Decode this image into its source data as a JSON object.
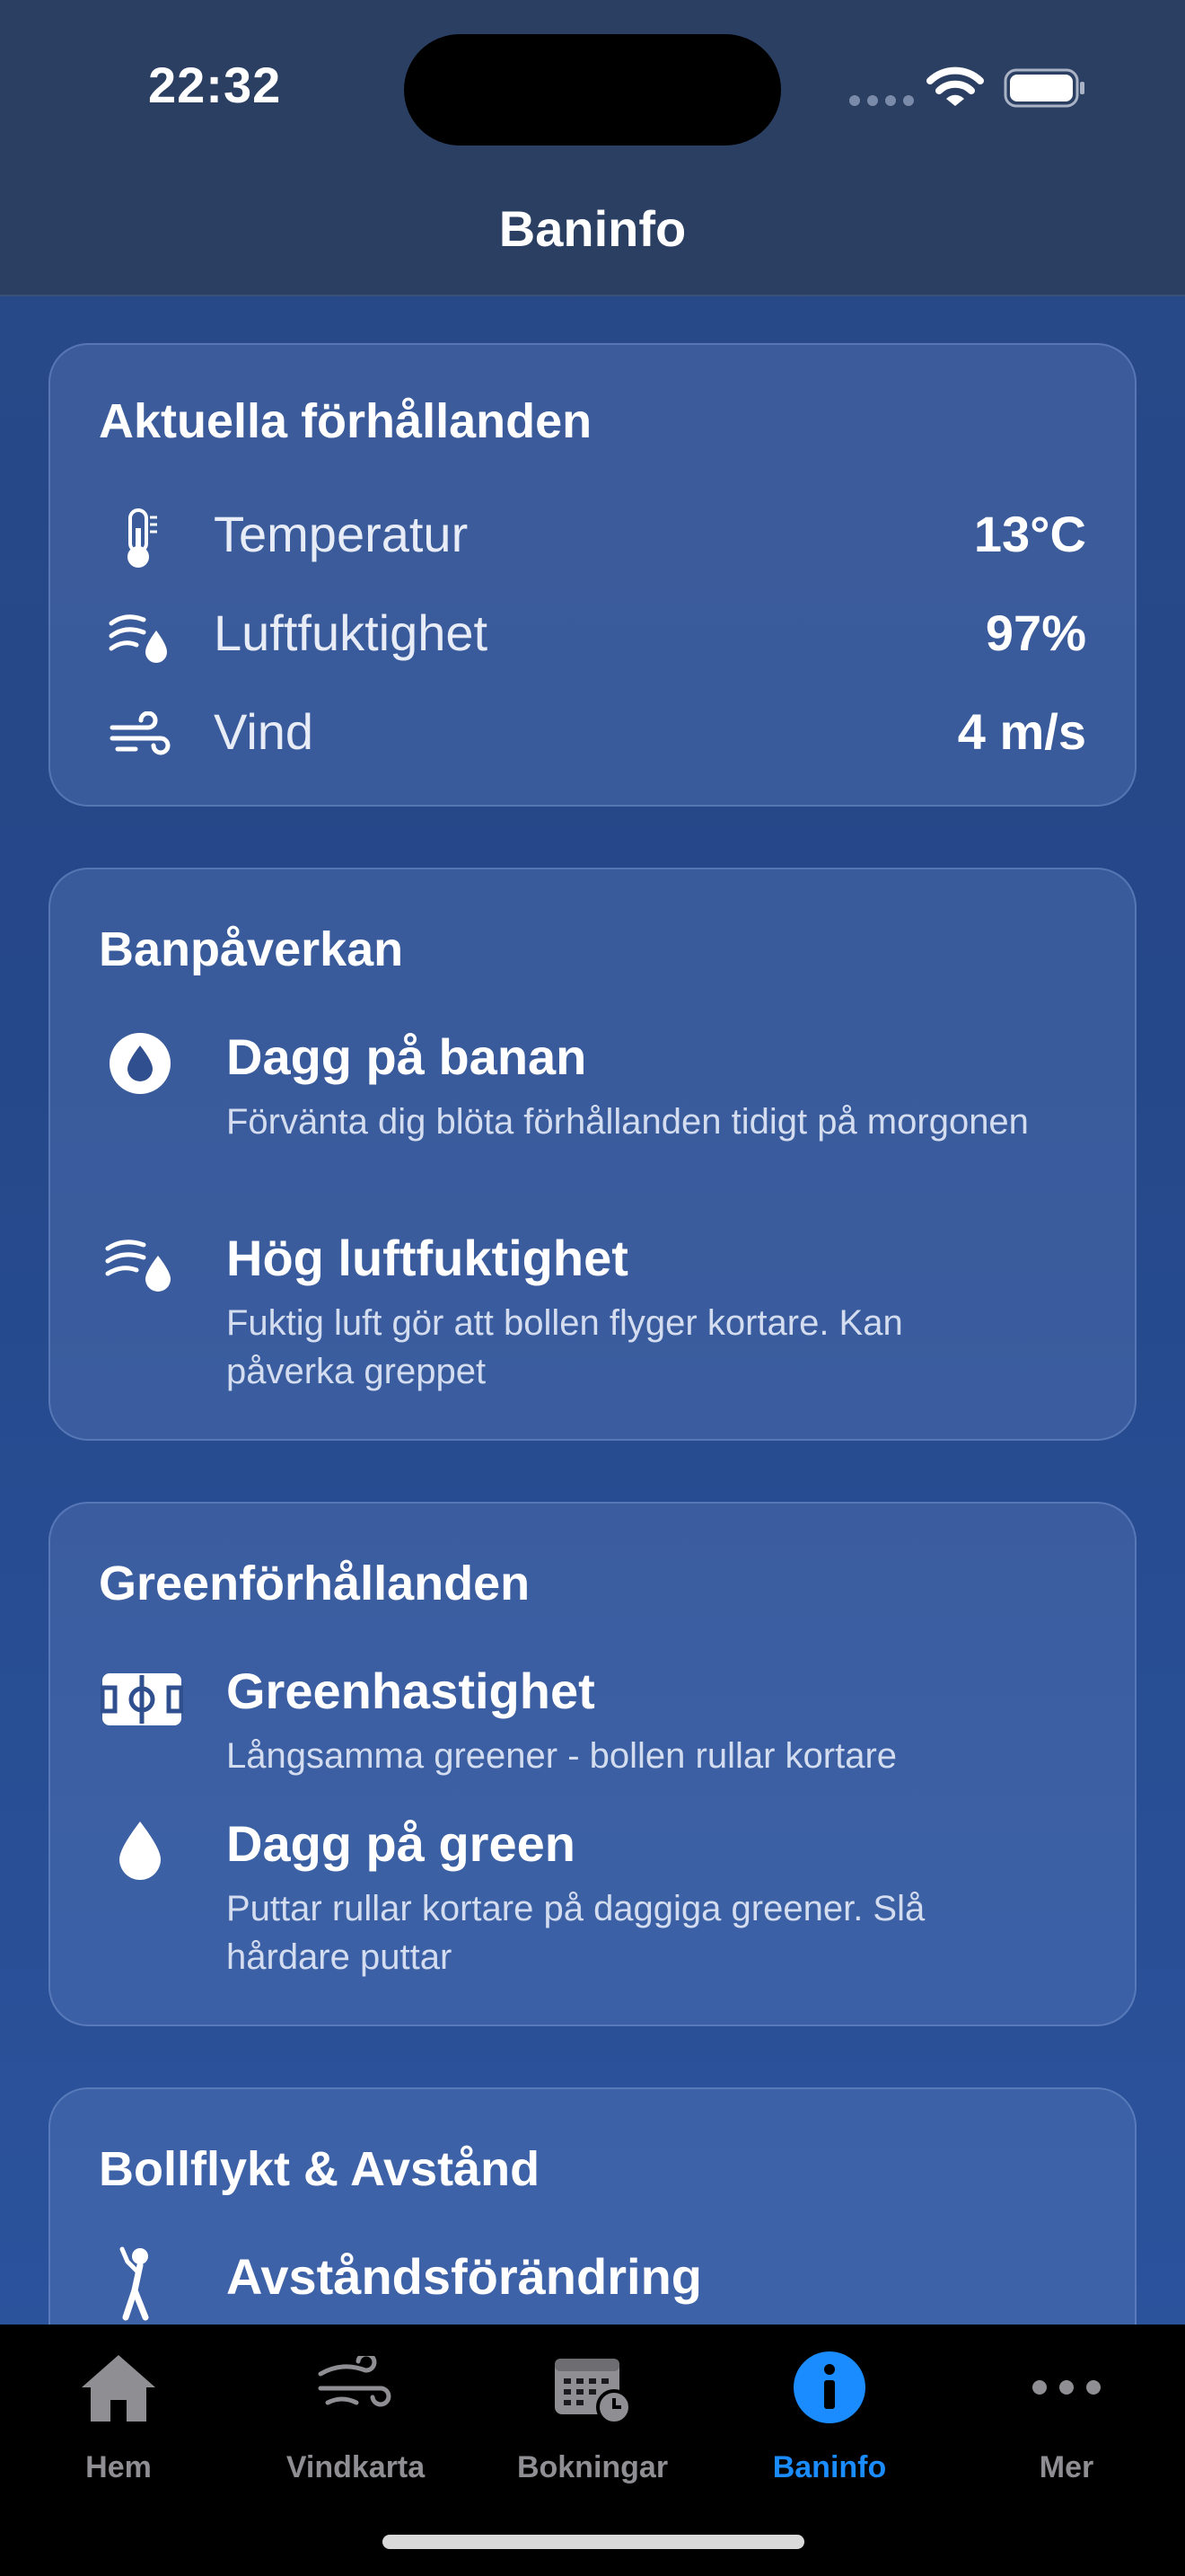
{
  "status_bar": {
    "time": "22:32"
  },
  "nav": {
    "title": "Baninfo"
  },
  "conditions": {
    "title": "Aktuella förhållanden",
    "rows": [
      {
        "icon": "thermometer-icon",
        "label": "Temperatur",
        "value": "13°C"
      },
      {
        "icon": "humidity-icon",
        "label": "Luftfuktighet",
        "value": "97%"
      },
      {
        "icon": "wind-icon",
        "label": "Vind",
        "value": "4 m/s"
      }
    ]
  },
  "course_impact": {
    "title": "Banpåverkan",
    "items": [
      {
        "icon": "dew-drop-circle-icon",
        "title": "Dagg på banan",
        "desc": "Förvänta dig blöta förhållanden tidigt på morgonen"
      },
      {
        "icon": "humidity-icon",
        "title": "Hög luftfuktighet",
        "desc": "Fuktig luft gör att bollen flyger kortare. Kan påverka greppet"
      }
    ]
  },
  "green_conditions": {
    "title": "Greenförhållanden",
    "items": [
      {
        "icon": "green-speed-icon",
        "title": "Greenhastighet",
        "desc": "Långsamma greener - bollen rullar kortare"
      },
      {
        "icon": "drop-icon",
        "title": "Dagg på green",
        "desc": "Puttar rullar kortare på daggiga greener. Slå hårdare puttar"
      }
    ]
  },
  "ball_flight": {
    "title": "Bollflykt & Avstånd",
    "items": [
      {
        "icon": "golfer-icon",
        "title": "Avståndsförändring"
      }
    ]
  },
  "tabs": [
    {
      "icon": "home-icon",
      "label": "Hem",
      "active": false
    },
    {
      "icon": "wind-map-icon",
      "label": "Vindkarta",
      "active": false
    },
    {
      "icon": "calendar-clock-icon",
      "label": "Bokningar",
      "active": false
    },
    {
      "icon": "info-icon",
      "label": "Baninfo",
      "active": true
    },
    {
      "icon": "more-icon",
      "label": "Mer",
      "active": false
    }
  ],
  "colors": {
    "accent": "#1a8cff",
    "inactive_tab": "#8e8e93",
    "background_top": "#294987",
    "header": "#2b3f63"
  }
}
